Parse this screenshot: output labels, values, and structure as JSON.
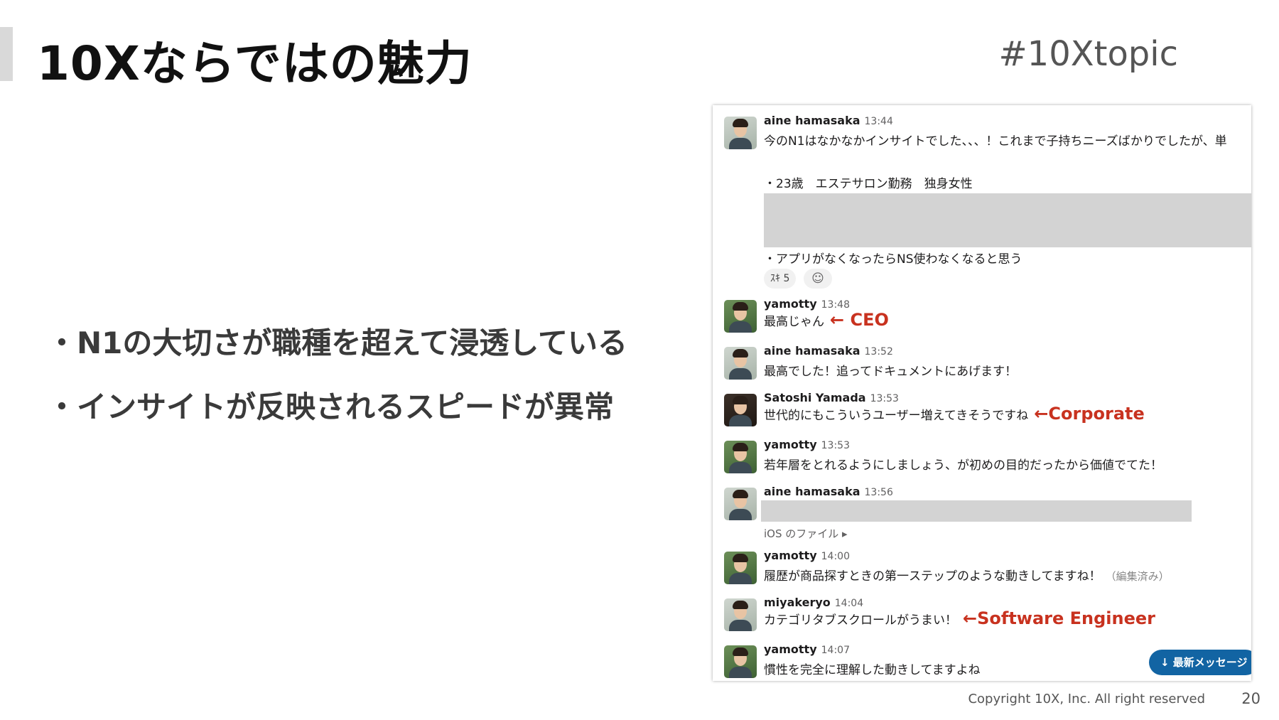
{
  "slide": {
    "title": "10Xならではの魅力",
    "hashtag": "#10Xtopic",
    "bullets": [
      "・N1の大切さが職種を超えて浸透している",
      "・インサイトが反映されるスピードが異常"
    ],
    "footer": {
      "copyright": "Copyright 10X, Inc. All right reserved",
      "page_number": "20"
    }
  },
  "slack": {
    "messages": [
      {
        "user": "aine hamasaka",
        "time": "13:44",
        "text": "今のN1はなかなかインサイトでした、、、！これまで子持ちニーズばかりでしたが、単",
        "line2": "・23歳　エステサロン勤務　独身女性",
        "line3": "・アプリがなくなったらNS使わなくなると思う",
        "reaction_label": "ｽｷ",
        "reaction_count": "5"
      },
      {
        "user": "yamotty",
        "time": "13:48",
        "text": "最高じゃん",
        "note": "← CEO"
      },
      {
        "user": "aine hamasaka",
        "time": "13:52",
        "text": "最高でした！追ってドキュメントにあげます！"
      },
      {
        "user": "Satoshi Yamada",
        "time": "13:53",
        "text": "世代的にもこういうユーザー増えてきそうですね",
        "note": "←Corporate"
      },
      {
        "user": "yamotty",
        "time": "13:53",
        "text": "若年層をとれるようにしましょう、が初めの目的だったから価値でてた！"
      },
      {
        "user": "aine hamasaka",
        "time": "13:56",
        "file_label": "iOS のファイル ▸"
      },
      {
        "user": "yamotty",
        "time": "14:00",
        "text": "履歴が商品探すときの第一ステップのような動きしてますね！",
        "edited": "（編集済み）"
      },
      {
        "user": "miyakeryo",
        "time": "14:04",
        "text": "カテゴリタブスクロールがうまい！",
        "note": "←Software Engineer"
      },
      {
        "user": "yamotty",
        "time": "14:07",
        "text": "慣性を完全に理解した動きしてますよね"
      }
    ],
    "new_messages_button": "↓  最新メッセージ"
  },
  "colors": {
    "annotation_red": "#c8321f",
    "slack_blue": "#1264a3"
  }
}
